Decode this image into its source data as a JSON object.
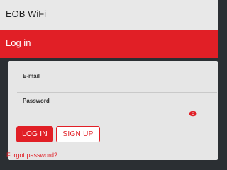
{
  "header": {
    "title": "EOB WiFi"
  },
  "section": {
    "title": "Log in"
  },
  "form": {
    "email_label": "E-mail",
    "email_value": "",
    "password_label": "Password",
    "password_value": "",
    "login_label": "LOG IN",
    "signup_label": "SIGN UP",
    "forgot_label": "Forgot password?"
  },
  "colors": {
    "accent": "#e11f26",
    "background": "#2b2f33",
    "panel": "#e6e6e6",
    "topbar": "#e8e8e8"
  },
  "icons": {
    "password_toggle": "eye-icon"
  }
}
